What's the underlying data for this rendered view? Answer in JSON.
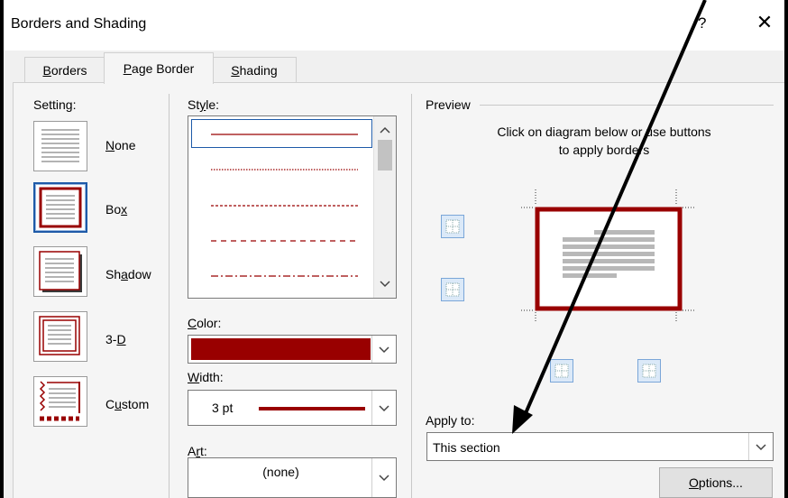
{
  "window": {
    "title": "Borders and Shading",
    "help_glyph": "?",
    "close_glyph": "✕"
  },
  "tabs": [
    {
      "label": "Borders",
      "hotkey": "B",
      "rest": "orders",
      "active": false
    },
    {
      "label": "Page Border",
      "hotkey": "P",
      "rest": "age Border",
      "active": true
    },
    {
      "label": "Shading",
      "hotkey": "S",
      "rest": "hading",
      "active": false
    }
  ],
  "setting": {
    "label": "Setting:",
    "items": [
      {
        "pre": "",
        "hot": "N",
        "post": "one",
        "selected": false
      },
      {
        "pre": "Bo",
        "hot": "x",
        "post": "",
        "selected": true
      },
      {
        "pre": "Sh",
        "hot": "a",
        "post": "dow",
        "selected": false
      },
      {
        "pre": "3-",
        "hot": "D",
        "post": "",
        "selected": false
      },
      {
        "pre": "C",
        "hot": "u",
        "post": "stom",
        "selected": false
      }
    ]
  },
  "style": {
    "pre": "St",
    "hot": "y",
    "post": "le:"
  },
  "color": {
    "pre": "",
    "hot": "C",
    "post": "olor:",
    "value": "#990000"
  },
  "width": {
    "pre": "",
    "hot": "W",
    "post": "idth:",
    "value": "3 pt"
  },
  "art": {
    "pre": "A",
    "hot": "r",
    "post": "t:",
    "value": "(none)"
  },
  "preview": {
    "label": "Preview",
    "instructions_1": "Click on diagram below or use buttons",
    "instructions_2": "to apply borders"
  },
  "apply_to": {
    "label": "Apply to:",
    "value": "This section"
  },
  "options_button": {
    "hot": "O",
    "post": "ptions..."
  },
  "colors": {
    "border_red": "#990000",
    "accent_blue": "#1e5aa8"
  }
}
